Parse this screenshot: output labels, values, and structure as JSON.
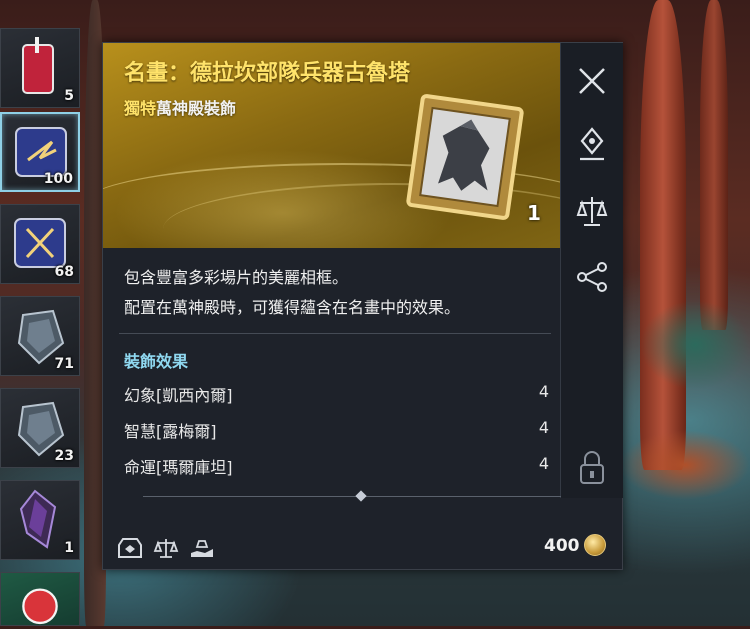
{
  "inventory": [
    {
      "count": "5",
      "icon": "red-drink-icon"
    },
    {
      "count": "100",
      "icon": "blue-scroll-icon"
    },
    {
      "count": "68",
      "icon": "blue-scroll-swords-icon"
    },
    {
      "count": "71",
      "icon": "silver-gem-icon"
    },
    {
      "count": "23",
      "icon": "silver-gem-icon"
    },
    {
      "count": "1",
      "icon": "purple-crystal-icon"
    },
    {
      "count": "",
      "icon": "red-candy-icon"
    }
  ],
  "item": {
    "title": "名畫：德拉坎部隊兵器古魯塔",
    "rarity": "獨特",
    "category": "萬神殿裝飾",
    "count": "1",
    "description": [
      "包含豐富多彩場片的美麗相框。",
      "配置在萬神殿時，可獲得蘊含在名畫中的效果。"
    ],
    "effects_title": "裝飾效果",
    "effects": [
      {
        "name": "幻象[凱西內爾]",
        "value": "4"
      },
      {
        "name": "智慧[露梅爾]",
        "value": "4"
      },
      {
        "name": "命運[瑪爾庫坦]",
        "value": "4"
      }
    ],
    "price": "400"
  },
  "side_buttons": [
    "close-icon",
    "location-pin-icon",
    "scales-icon",
    "share-icon",
    "lock-icon"
  ],
  "footer_icons": [
    "storage-icon",
    "trade-scales-icon",
    "give-hand-icon"
  ],
  "colors": {
    "title": "#ffe36a",
    "effects_title": "#8fd8f0",
    "panel": "#1e222a",
    "header_gold": "#a07d18"
  }
}
